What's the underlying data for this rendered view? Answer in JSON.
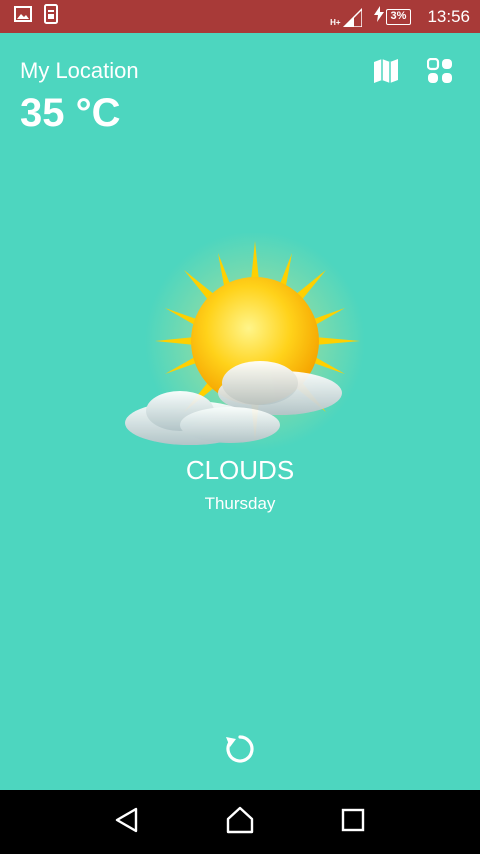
{
  "status_bar": {
    "time": "13:56",
    "battery": "3%",
    "network": "H+",
    "icons": [
      "image-notification-icon",
      "sim-notification-icon",
      "signal-icon",
      "charging-icon",
      "battery-icon"
    ]
  },
  "header": {
    "location": "My Location",
    "temperature": "35 °C",
    "actions": [
      "map-icon",
      "grid-icon"
    ]
  },
  "weather": {
    "condition": "CLOUDS",
    "day": "Thursday",
    "illustration": "sun-behind-clouds-icon"
  },
  "footer": {
    "refresh_icon": "refresh-icon"
  },
  "nav_bar": {
    "buttons": [
      "back-icon",
      "home-icon",
      "recents-icon"
    ]
  },
  "colors": {
    "background": "#4dd6bf",
    "status_bar": "#a83a38",
    "nav_bar": "#000000"
  }
}
